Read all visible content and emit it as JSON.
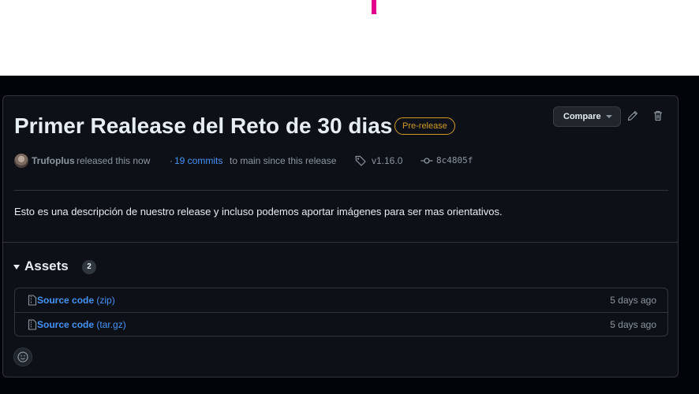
{
  "release": {
    "title": "Primer Realease del Reto de 30 dias",
    "badge": "Pre-release",
    "compare_label": "Compare",
    "author": "Trufoplus",
    "released_text": "released this now",
    "dot": "·",
    "commits_link": "19 commits",
    "since_text": "to main since this release",
    "tag": "v1.16.0",
    "sha": "8c4805f",
    "description": "Esto es una descripción de nuestro release y incluso podemos aportar imágenes para ser mas orientativos."
  },
  "assets": {
    "heading": "Assets",
    "count": "2",
    "items": [
      {
        "name": "Source code",
        "ext": "(zip)",
        "date": "5 days ago"
      },
      {
        "name": "Source code",
        "ext": "(tar.gz)",
        "date": "5 days ago"
      }
    ]
  },
  "colors": {
    "accent_pink": "#e3008c",
    "link": "#4493f8",
    "badge": "#d29922",
    "background": "#0d1117"
  },
  "icons": {
    "edit": "pencil-icon",
    "delete": "trash-icon",
    "tag": "tag-icon",
    "commit": "commit-icon",
    "archive": "file-zip-icon",
    "reaction": "smiley-icon"
  }
}
